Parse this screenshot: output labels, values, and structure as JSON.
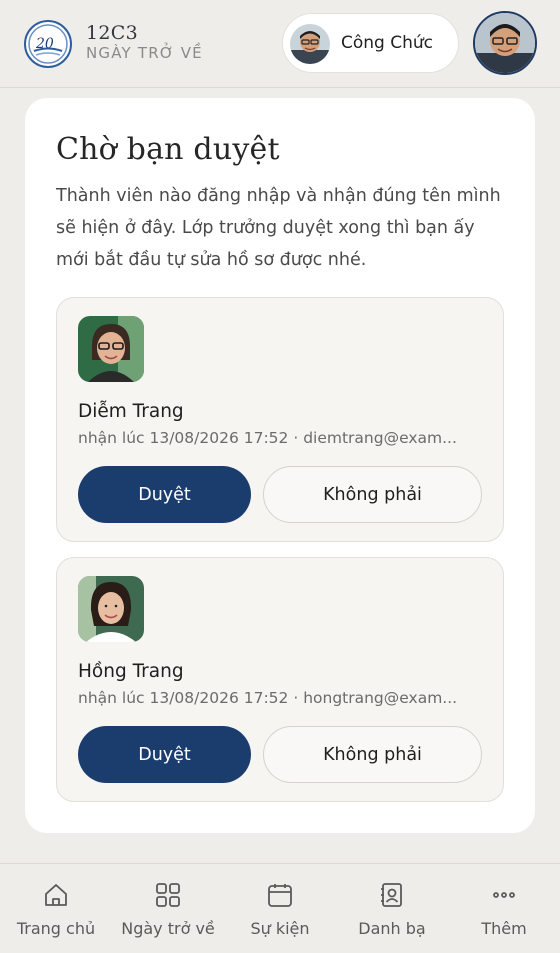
{
  "header": {
    "brand_title": "12C3",
    "brand_subtitle": "NGÀY TRỞ VỀ",
    "user_name": "Công Chức",
    "logo_icon": "class-reunion-20-logo"
  },
  "card": {
    "title": "Chờ bạn duyệt",
    "description": "Thành viên nào đăng nhập và nhận đúng tên mình sẽ hiện ở đây. Lớp trưởng duyệt xong thì bạn ấy mới bắt đầu tự sửa hồ sơ được nhé."
  },
  "members": [
    {
      "name": "Diễm Trang",
      "meta": "nhận lúc 13/08/2026 17:52 · diemtrang@exam...",
      "approve_label": "Duyệt",
      "reject_label": "Không phải"
    },
    {
      "name": "Hồng Trang",
      "meta": "nhận lúc 13/08/2026 17:52 · hongtrang@exam...",
      "approve_label": "Duyệt",
      "reject_label": "Không phải"
    }
  ],
  "nav": [
    {
      "label": "Trang chủ",
      "icon": "home-icon"
    },
    {
      "label": "Ngày trở về",
      "icon": "grid-icon"
    },
    {
      "label": "Sự kiện",
      "icon": "calendar-icon"
    },
    {
      "label": "Danh bạ",
      "icon": "contacts-icon"
    },
    {
      "label": "Thêm",
      "icon": "more-icon"
    }
  ],
  "colors": {
    "primary": "#1b3d6e",
    "background": "#efedea",
    "card": "#ffffff"
  }
}
